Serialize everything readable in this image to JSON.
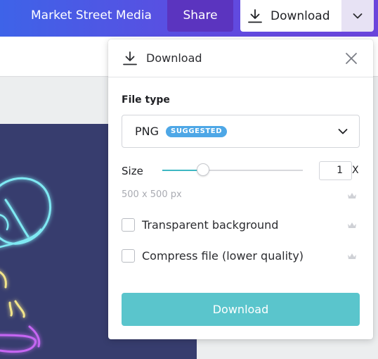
{
  "header": {
    "brand": "Market Street Media",
    "share_label": "Share",
    "download_label": "Download",
    "download_icon": "download-icon",
    "caret_icon": "chevron-down-icon"
  },
  "popup": {
    "title": "Download",
    "close_icon": "close-icon",
    "file_type_label": "File type",
    "file_type_value": "PNG",
    "file_type_badge": "SUGGESTED",
    "size_label": "Size",
    "size_value": "1",
    "size_multiplier": "X",
    "size_slider_fraction": 0.2,
    "dimensions": "500 x 500 px",
    "options": [
      {
        "label": "Transparent background",
        "checked": false,
        "premium": true
      },
      {
        "label": "Compress file (lower quality)",
        "checked": false,
        "premium": true
      }
    ],
    "download_button": "Download"
  },
  "colors": {
    "accent_teal": "#5ac5cc",
    "badge_blue": "#4ea7e6",
    "share_purple": "#5b34bf",
    "design_bg": "#373d6e"
  }
}
